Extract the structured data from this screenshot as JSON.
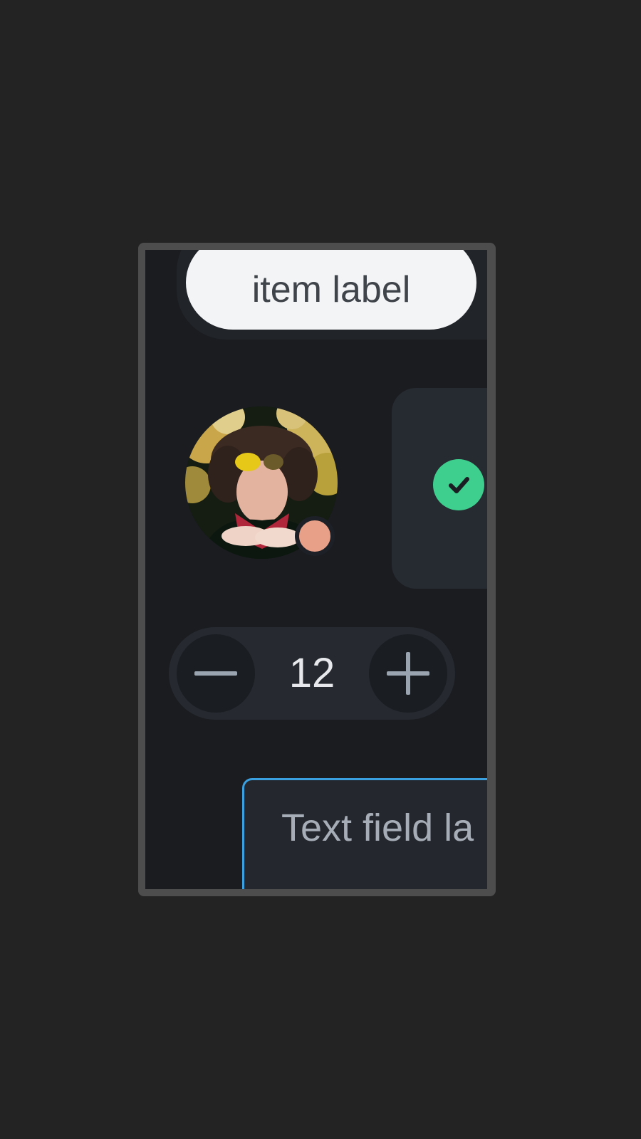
{
  "chip": {
    "label": "item label"
  },
  "avatar": {
    "status_color": "#e9a089"
  },
  "card": {
    "icon": "check-circle-icon",
    "icon_color": "#3ecf8e"
  },
  "stepper": {
    "value": "12",
    "minus_icon": "minus-icon",
    "plus_icon": "plus-icon"
  },
  "text_field": {
    "label": "Text field la"
  },
  "colors": {
    "background": "#232323",
    "frame": "#4d4d4d",
    "surface": "#1a1c20",
    "chip_bg": "#f3f4f6",
    "focus_border": "#3ba0e0"
  }
}
